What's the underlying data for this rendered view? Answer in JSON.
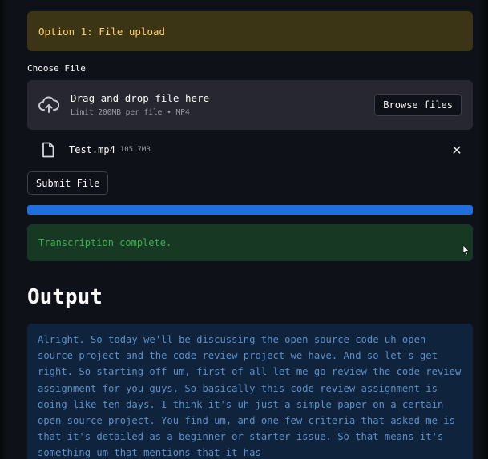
{
  "info_box": {
    "text": "Option 1: File upload",
    "color": "#ffd16a"
  },
  "uploader": {
    "label": "Choose File",
    "icon": "cloud-upload-icon",
    "title": "Drag and drop file here",
    "subtitle": "Limit 200MB per file • MP4",
    "browse_label": "Browse files"
  },
  "uploaded_file": {
    "icon": "file-icon",
    "name": "Test.mp4",
    "size": "105.7MB",
    "remove_icon": "close-icon",
    "remove_symbol": "✕"
  },
  "submit": {
    "label": "Submit File"
  },
  "progress": {
    "value_percent": 100,
    "color": "#1f6fde"
  },
  "status": {
    "text": "Transcription complete.",
    "color": "#37b24d"
  },
  "output": {
    "title": "Output",
    "text": "Alright. So today we'll be discussing the open source code uh open source project and the code review project we have. And so let's get right. So starting off um, first of all let me go review the code review assignment for you guys. So basically this code review assignment is doing like ten days. I think it's uh just a simple paper on a certain open source project. You find um, and one few criteria that asked me is that it's detailed as a beginner or starter issue. So that means it's something um that mentions that it has"
  }
}
